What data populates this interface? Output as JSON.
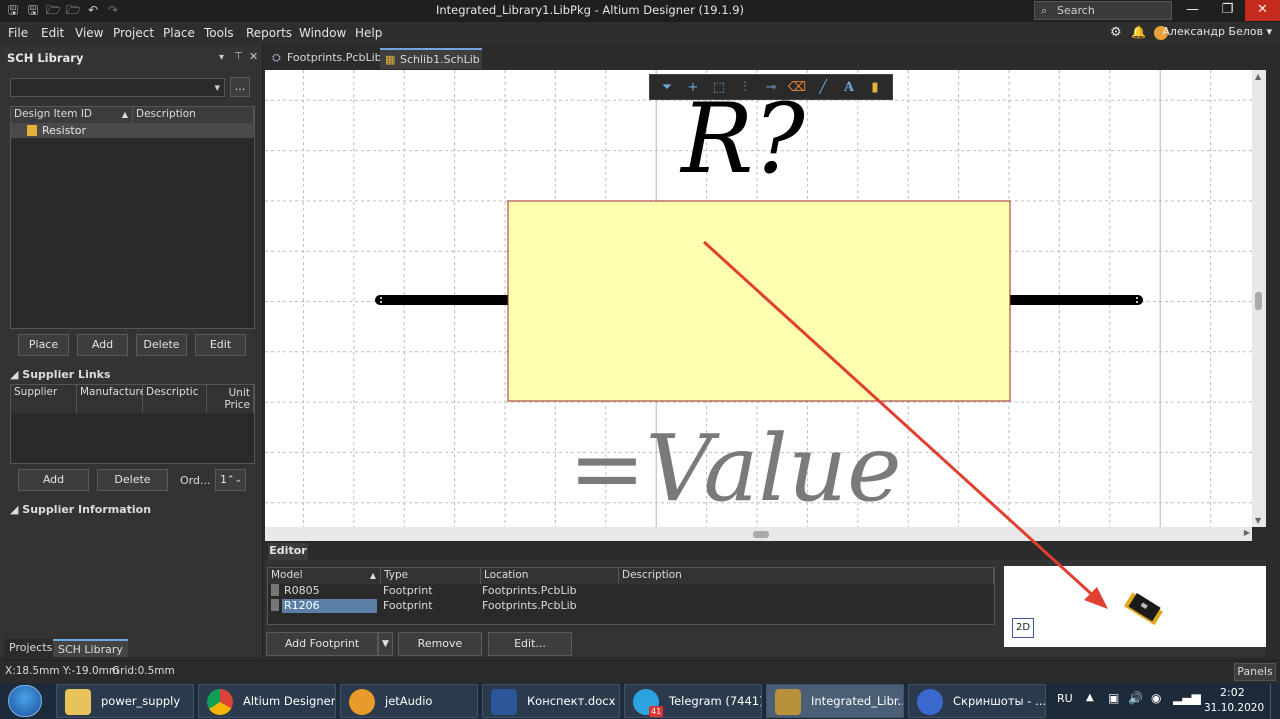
{
  "window": {
    "title": "Integrated_Library1.LibPkg - Altium Designer (19.1.9)",
    "search_placeholder": "Search",
    "minimize": "—",
    "maximize": "❐",
    "close": "✕"
  },
  "menu": [
    "File",
    "Edit",
    "View",
    "Project",
    "Place",
    "Tools",
    "Reports",
    "Window",
    "Help"
  ],
  "user": {
    "name": "Александр Белов ▾"
  },
  "sch_library": {
    "title": "SCH Library",
    "filter_dropdown": "▾",
    "browse_button": "...",
    "columns": [
      "Design Item ID",
      "Description"
    ],
    "items": [
      "Resistor"
    ],
    "buttons": [
      "Place",
      "Add",
      "Delete",
      "Edit"
    ],
    "supplier_links": {
      "title": "Supplier Links",
      "columns": [
        "Supplier",
        "Manufacture",
        "Descriptic",
        "Unit Price"
      ],
      "unit_price_line1": "Unit",
      "unit_price_line2": "Price",
      "buttons": [
        "Add",
        "Delete"
      ],
      "order_label": "Ord...",
      "order_value": "1"
    },
    "supplier_info_title": "Supplier Information",
    "bottom_tabs": [
      "Projects",
      "SCH Library"
    ]
  },
  "doc_tabs": [
    "Footprints.PcbLib",
    "Schlib1.SchLib *"
  ],
  "schematic": {
    "designator": "R?",
    "value_text": "=Value",
    "body_fill": "#ffffb0",
    "body_stroke": "#9c2b2b"
  },
  "editor": {
    "tab": "Editor",
    "columns": [
      "Model",
      "Type",
      "Location",
      "Description"
    ],
    "rows": [
      {
        "model": "R0805",
        "type": "Footprint",
        "location": "Footprints.PcbLib",
        "description": ""
      },
      {
        "model": "R1206",
        "type": "Footprint",
        "location": "Footprints.PcbLib",
        "description": ""
      }
    ],
    "buttons": {
      "add_footprint": "Add Footprint",
      "remove": "Remove",
      "edit": "Edit..."
    },
    "preview_mode": "2D"
  },
  "status": {
    "coords": "X:18.5mm Y:-19.0mm",
    "grid": "Grid:0.5mm",
    "panels": "Panels"
  },
  "taskbar": {
    "apps": [
      "power_supply",
      "Altium Designer...",
      "jetAudio",
      "Конспект.docx ...",
      "Telegram (7441)",
      "Integrated_Libr...",
      "Скриншоты - ..."
    ],
    "telegram_badge": "41",
    "lang": "RU",
    "time": "2:02",
    "date": "31.10.2020"
  },
  "colors": {
    "annotation_arrow": "#e0402f",
    "accent": "#6fa8dc"
  }
}
